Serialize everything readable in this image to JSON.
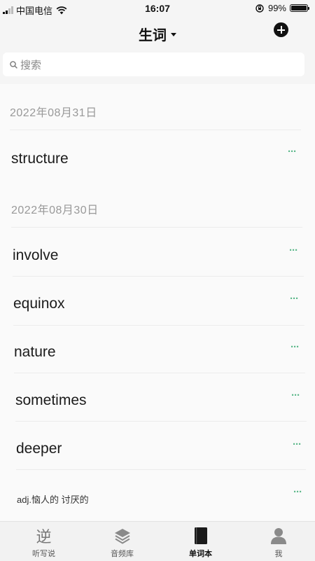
{
  "status": {
    "carrier": "中国电信",
    "time": "16:07",
    "battery": "99%",
    "battery_level": 0.99
  },
  "header": {
    "title": "生词"
  },
  "search": {
    "placeholder": "搜索"
  },
  "groups": [
    {
      "date": "2022年08月31日",
      "items": [
        {
          "word": "structure"
        }
      ]
    },
    {
      "date": "2022年08月30日",
      "items": [
        {
          "word": "involve"
        },
        {
          "word": "equinox"
        },
        {
          "word": "nature"
        },
        {
          "word": "sometimes"
        },
        {
          "word": "deeper"
        },
        {
          "note": "adj.恼人的 讨厌的"
        }
      ]
    }
  ],
  "more_label": "···",
  "tabs": [
    {
      "label": "听写说",
      "icon": "ni-character-icon"
    },
    {
      "label": "音频库",
      "icon": "layers-icon"
    },
    {
      "label": "单词本",
      "icon": "book-icon",
      "active": true
    },
    {
      "label": "我",
      "icon": "person-icon"
    }
  ],
  "tab_glyph_0": "逆"
}
